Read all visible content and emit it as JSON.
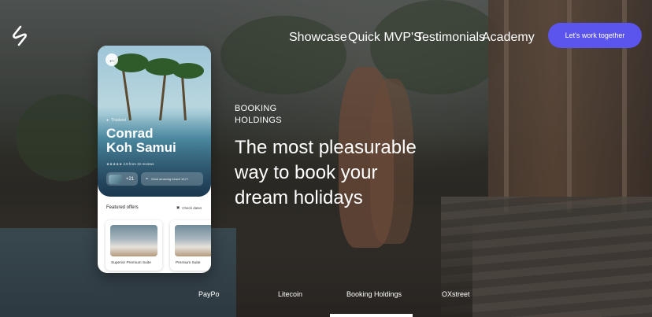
{
  "nav": {
    "items": [
      "Showcase",
      "Quick MVP'S",
      "Testimonials",
      "Academy"
    ],
    "cta_label": "Let's work together"
  },
  "colors": {
    "accent": "#5b55ee"
  },
  "phone": {
    "back_icon": "arrow-left-icon",
    "location": "Thailand",
    "hotel_line1": "Conrad",
    "hotel_line2": "Koh Samui",
    "rating_text": "★★★★★ 4.9 from 32 reviews",
    "guest_count": "+21",
    "amenity_text": "Most amazing beach W-Fi",
    "featured_title": "Featured offers",
    "check_dates": "Check dates",
    "rooms": [
      {
        "label": "Superior Premium Suite"
      },
      {
        "label": "Premium Suite"
      }
    ]
  },
  "hero": {
    "eyebrow_line1": "BOOKING",
    "eyebrow_line2": "HOLDINGS",
    "headline_line1": "The most pleasurable",
    "headline_line2": "way to book your",
    "headline_line3": "dream holidays"
  },
  "clients": [
    "PayPo",
    "Litecoin",
    "Booking Holdings",
    "OXstreet"
  ]
}
